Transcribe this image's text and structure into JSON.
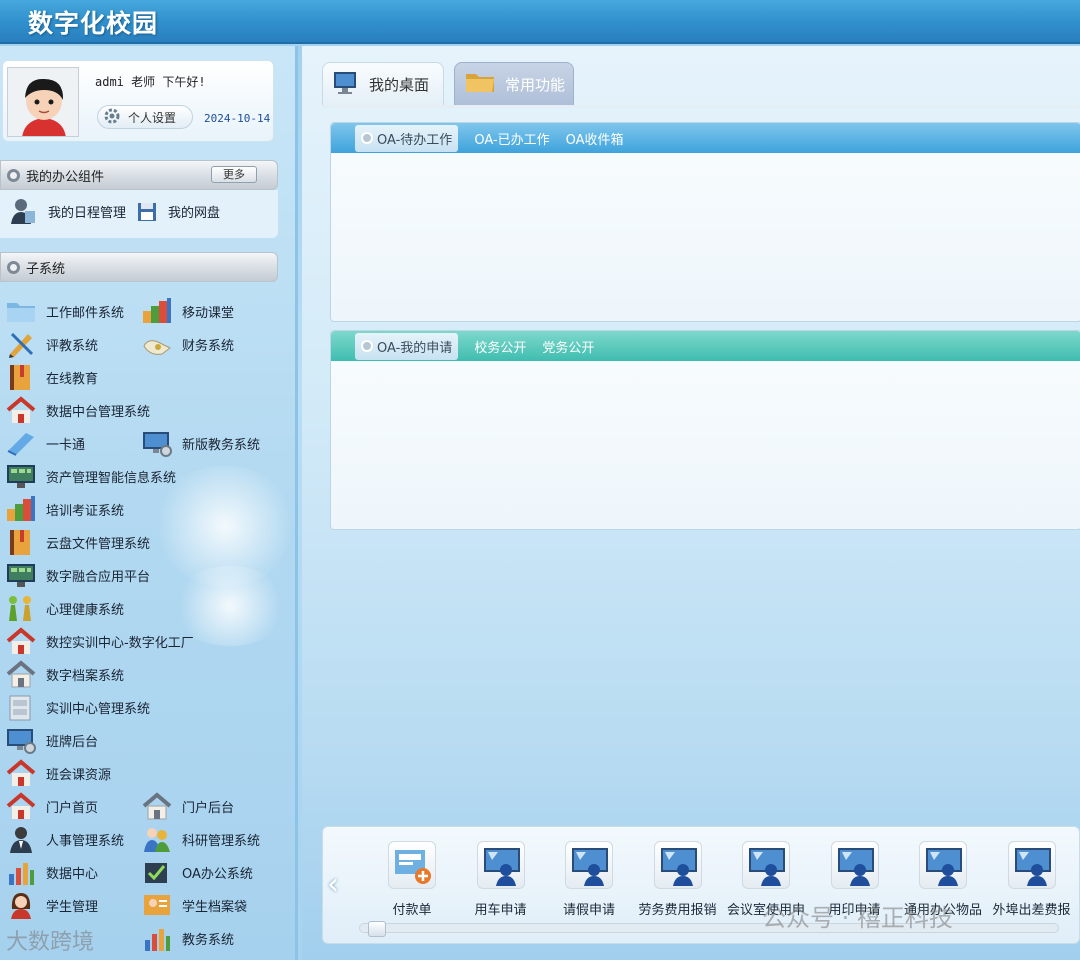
{
  "app": {
    "title": "数字化校园"
  },
  "user": {
    "greeting": "admi 老师 下午好!",
    "settings_label": "个人设置",
    "date": "2024-10-14"
  },
  "office": {
    "title": "我的办公组件",
    "more_label": "更多",
    "items": [
      "我的日程管理",
      "我的网盘"
    ]
  },
  "subsystems": {
    "title": "子系统",
    "left": [
      "工作邮件系统",
      "评教系统",
      "在线教育",
      "数据中台管理系统",
      "一卡通",
      "资产管理智能信息系统",
      "培训考证系统",
      "云盘文件管理系统",
      "数字融合应用平台",
      "心理健康系统",
      "数控实训中心-数字化工厂",
      "数字档案系统",
      "实训中心管理系统",
      "班牌后台",
      "班会课资源",
      "门户首页",
      "人事管理系统",
      "数据中心",
      "学生管理"
    ],
    "right": [
      "移动课堂",
      "财务系统",
      "新版教务系统",
      "门户后台",
      "科研管理系统",
      "OA办公系统",
      "学生档案袋",
      "教务系统"
    ]
  },
  "tabs": {
    "desktop": "我的桌面",
    "common": "常用功能"
  },
  "panel1": {
    "tabs": [
      "OA-待办工作",
      "OA-已办工作",
      "OA收件箱"
    ]
  },
  "panel2": {
    "tabs": [
      "OA-我的申请",
      "校务公开",
      "党务公开"
    ]
  },
  "quick": {
    "items": [
      "付款单",
      "用车申请",
      "请假申请",
      "劳务费用报销",
      "会议室使用申",
      "用印申请",
      "通用办公物品",
      "外埠出差费报"
    ]
  },
  "watermarks": {
    "left": "大数跨境",
    "right": "公众号 · 禧正科技"
  },
  "colors": {
    "header": "#2f8fcc",
    "panel_blue": "#3ea3dc",
    "panel_teal": "#3fbdb0",
    "date_text": "#1a4f9c"
  }
}
